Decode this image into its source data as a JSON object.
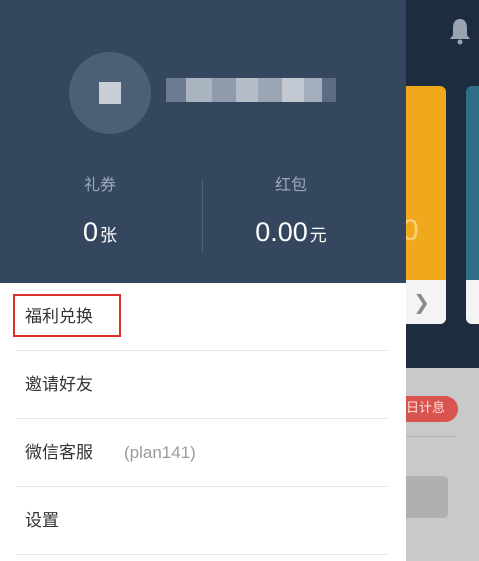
{
  "background_app": {
    "notification_icon": "bell-icon",
    "card_arrow_icon": "chevron-right-icon",
    "card_partial_value": "0",
    "pill_partial_text": "日计息",
    "colors": {
      "card_orange": "#f0a81c",
      "card_teal": "#2e6f88",
      "pill_red": "#d9534f"
    }
  },
  "drawer": {
    "header": {
      "avatar": "avatar-pixelated",
      "username": "",
      "stats": [
        {
          "label": "礼券",
          "value": "0",
          "unit": "张"
        },
        {
          "label": "红包",
          "value": "0.00",
          "unit": "元"
        }
      ],
      "colors": {
        "header_bg": "#34475f"
      }
    },
    "menu": [
      {
        "label": "福利兑换",
        "sub": ""
      },
      {
        "label": "邀请好友",
        "sub": ""
      },
      {
        "label": "微信客服",
        "sub": "(plan141)"
      },
      {
        "label": "设置",
        "sub": ""
      }
    ],
    "colors": {
      "highlight": "#e0302a"
    }
  }
}
